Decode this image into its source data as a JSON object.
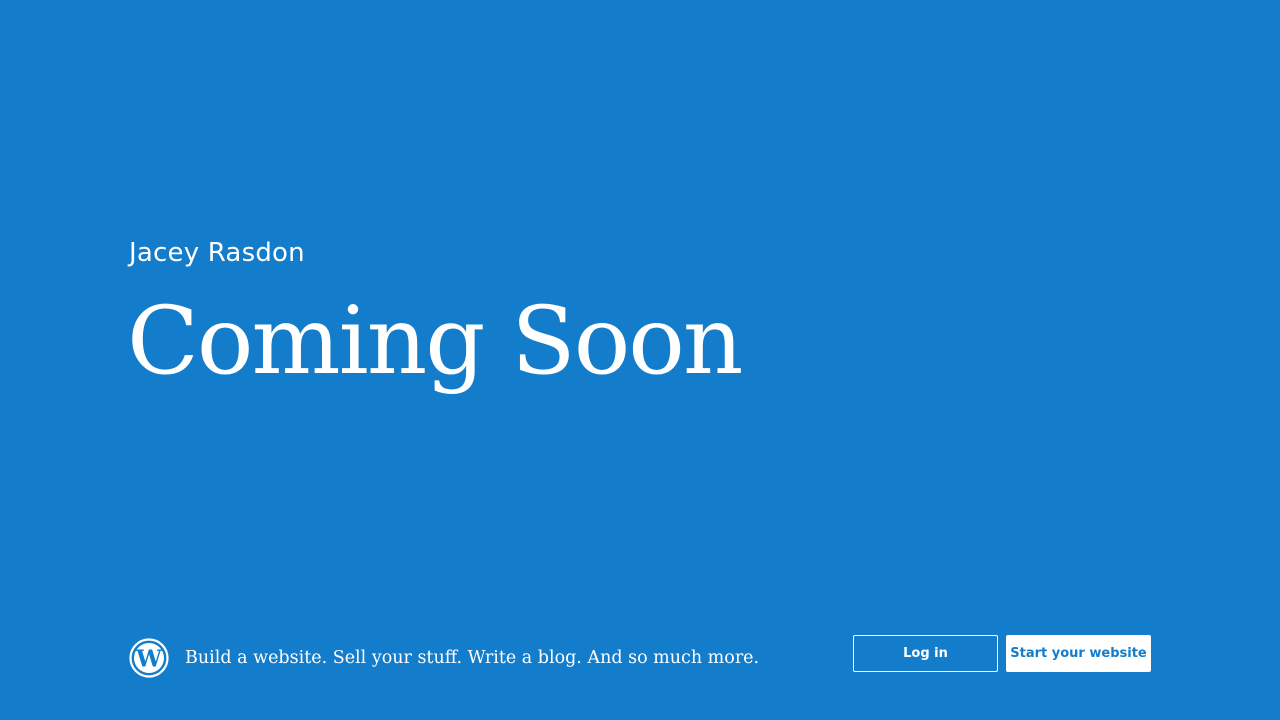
{
  "site": {
    "title": "Jacey Rasdon",
    "headline": "Coming Soon"
  },
  "footer": {
    "logo_icon": "wordpress-logo-icon",
    "tagline": "Build a website. Sell your stuff. Write a blog. And so much more.",
    "login_label": "Log in",
    "start_label": "Start your website"
  },
  "colors": {
    "background": "#137ccb",
    "text": "#ffffff",
    "button_primary_bg": "#ffffff",
    "button_primary_text": "#137ccb"
  }
}
